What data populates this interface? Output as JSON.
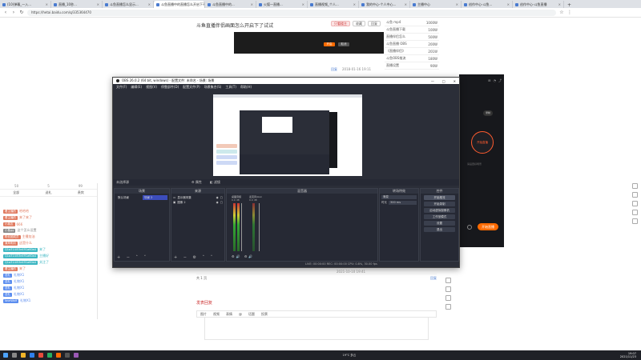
{
  "browser": {
    "tabs": [
      {
        "label": "(10)弹幕_一入...",
        "active": false
      },
      {
        "label": "直播_10秒...",
        "active": false
      },
      {
        "label": "斗鱼直播怎么显示...",
        "active": false
      },
      {
        "label": "斗鱼直播中的直播怎么开启下不...",
        "active": true
      },
      {
        "label": "斗鱼直播中的...",
        "active": false
      },
      {
        "label": "火狐一直播...",
        "active": false
      },
      {
        "label": "直播视频_个人...",
        "active": false
      },
      {
        "label": "我的中心-个人中心...",
        "active": false
      },
      {
        "label": "主播中心",
        "active": false
      },
      {
        "label": "创作中心-斗鱼...",
        "active": false
      },
      {
        "label": "创作中心-斗鱼直播",
        "active": false
      }
    ],
    "new_tab": "+",
    "url": "https://hetai.baidu.com/q/335364470"
  },
  "article": {
    "title": "斗鱼直播伴侣画面怎么开启下了试试",
    "actions": [
      "只看楼主",
      "收藏",
      "回复"
    ],
    "thumb_buttons": [
      "开启",
      "取消"
    ],
    "meta": "2018-01-16 19:11",
    "reply_label": "回复",
    "floor_label": "1楼",
    "bottom_meta": "2021-10-10 19:41",
    "comment_count": "共 1 页",
    "editor_title": "发表回复",
    "editor_tools": [
      "图片",
      "视频",
      "表情",
      "@",
      "话题",
      "投票"
    ]
  },
  "sidebar_list": [
    {
      "title": "斗鱼 mp4",
      "count": "1000W"
    },
    {
      "title": "斗鱼直播下载",
      "count": "100W"
    },
    {
      "title": "直播伴侣怎么",
      "count": "500W"
    },
    {
      "title": "斗鱼直播 OBS",
      "count": "200W"
    },
    {
      "title": "《直播伴侣》",
      "count": "201W"
    },
    {
      "title": "斗鱼OBS推流",
      "count": "180W"
    },
    {
      "title": "直播设置",
      "count": "90W"
    }
  ],
  "chat": {
    "tabs": [
      "全部",
      "送礼",
      "贵宾"
    ],
    "stats": [
      "50",
      "5",
      "99"
    ],
    "messages": [
      {
        "user": "看主播的",
        "text": "哈哈哈",
        "color": "#e07a5f"
      },
      {
        "user": "看主播的",
        "text": "来了来了",
        "color": "#e07a5f"
      },
      {
        "user": "小朋友",
        "text": "666",
        "color": "#e07a5f"
      },
      {
        "user": "小鱼gg",
        "text": "这个怎么设置",
        "color": "#888"
      },
      {
        "user": "粉丝团成员",
        "text": "主播加油",
        "color": "#e07a5f"
      },
      {
        "user": "清风明月",
        "text": "这是什么",
        "color": "#e07a5f"
      },
      {
        "user": "Q1a314i53e491a60a4",
        "text": "来了",
        "color": "#3cb6c2"
      },
      {
        "user": "Q1a314i53e491a60a4",
        "text": "主播好",
        "color": "#3cb6c2"
      },
      {
        "user": "Q1a314i53e491a60a4",
        "text": "关注了",
        "color": "#3cb6c2"
      },
      {
        "user": "看主播的",
        "text": "来了",
        "color": "#e07a5f"
      },
      {
        "user": "送礼",
        "text": "礼物X1",
        "color": "#5b8def"
      },
      {
        "user": "送礼",
        "text": "礼物X1",
        "color": "#5b8def"
      },
      {
        "user": "送礼",
        "text": "礼物X1",
        "color": "#5b8def"
      },
      {
        "user": "送礼",
        "text": "礼物X1",
        "color": "#5b8def"
      },
      {
        "user": "loveWolf",
        "text": "礼物X1",
        "color": "#5b8def"
      }
    ]
  },
  "obs": {
    "title": "OBS 26.0.2 (64 bit, windows) - 配置文件: 未命名 - 场景: 场景",
    "menu": [
      "文件(F)",
      "编辑(E)",
      "视图(V)",
      "停靠部件(D)",
      "配置文件(P)",
      "场景集合(S)",
      "工具(T)",
      "帮助(H)"
    ],
    "window_controls": [
      "—",
      "□",
      "✕"
    ],
    "no_source": "未选择源",
    "properties": "属性",
    "filters": "滤镜",
    "docks": {
      "scenes": "场景",
      "sources": "来源",
      "mixer": "混音器",
      "transition": "转场特效",
      "controls": "控件"
    },
    "scene_items": [
      "默认场景",
      "场景 2"
    ],
    "source_items": [
      "显示器采集",
      "图像 2"
    ],
    "mixer_channels": [
      {
        "name": "桌面音频",
        "db": "0.0 dB"
      },
      {
        "name": "麦克风/Aux",
        "db": "0.0 dB"
      }
    ],
    "transition_type": "渐变",
    "transition_duration": "300 ms",
    "transition_label": "时长",
    "controls": [
      "开始推流",
      "开始录制",
      "启动虚拟摄像机",
      "工作室模式",
      "设置",
      "退出"
    ],
    "status": "LIVE: 00:00:00   REC: 00:00:00   CPU: 0.8%, 30.00 fps"
  },
  "companion": {
    "start_live": "开始直播",
    "record": "录制",
    "go_live": "开始直播",
    "hint": "请设置好场景"
  },
  "taskbar": {
    "weather": "19°C 多云",
    "time": "19:07",
    "date": "2021/11/23"
  },
  "colors": {
    "accent_orange": "#ff6a00",
    "obs_bg": "#2b2e38",
    "chat_badge_blue": "#5b8def"
  }
}
